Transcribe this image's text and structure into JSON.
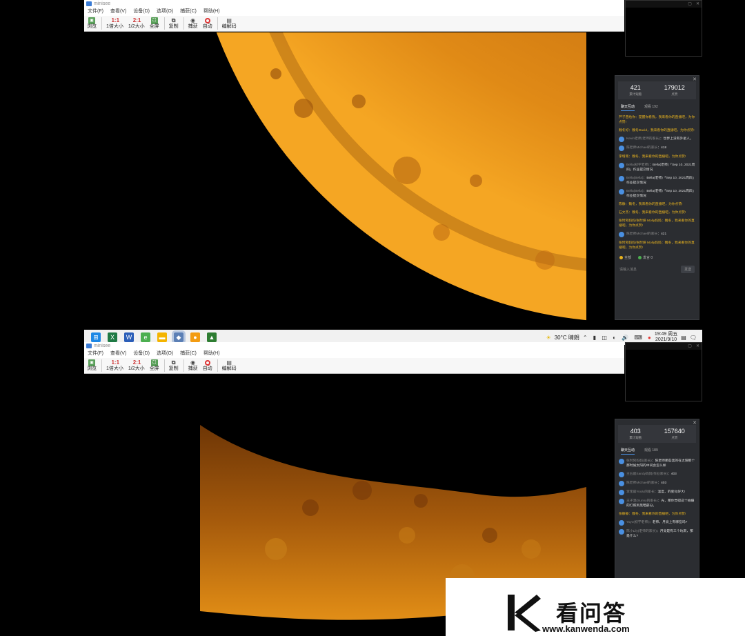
{
  "app": {
    "title": "minisee",
    "menus": [
      "文件(F)",
      "查看(V)",
      "设备(D)",
      "选项(O)",
      "捕获(C)",
      "帮助(H)"
    ],
    "toolbar": [
      {
        "icon": "image-icon",
        "glyph": "▣",
        "label": "浏览"
      },
      {
        "icon": "scale-1-1-icon",
        "glyph": "1:1",
        "label": "1倍大小"
      },
      {
        "icon": "scale-2-1-icon",
        "glyph": "2:1",
        "label": "1/2大小"
      },
      {
        "icon": "fullscreen-icon",
        "glyph": "⛶",
        "label": "全屏"
      },
      {
        "icon": "copy-icon",
        "glyph": "⧉",
        "label": "复制"
      },
      {
        "icon": "camera-icon",
        "glyph": "◉",
        "label": "捕获"
      },
      {
        "icon": "record-icon",
        "glyph": "",
        "label": "自动"
      },
      {
        "icon": "edit-icon",
        "glyph": "▤",
        "label": "编解码"
      }
    ]
  },
  "panel_top": {
    "stats": [
      {
        "num": "421",
        "label": "累计观看"
      },
      {
        "num": "179012",
        "label": "点赞"
      }
    ],
    "tabs": [
      "聊天互动",
      "观看 192"
    ],
    "messages": [
      {
        "kind": "yellow",
        "text": "芦子苗给你：提醒你看我，我来看你的直播吧，为你点赞!"
      },
      {
        "kind": "yellow",
        "text": "魏冬好：魏冬David，我来看你的直播吧，为你点赞!"
      },
      {
        "kind": "user",
        "nick": "Kevin老师(老师的家长)",
        "text": "：世界上没有外星人。"
      },
      {
        "kind": "user",
        "nick": "陈老师Michael的家长",
        "text": "：418"
      },
      {
        "kind": "yellow",
        "text": "李增南：魏冬，我来看你的直播吧，为你点赞!"
      },
      {
        "kind": "user",
        "nick": "Bella(初学老师)",
        "text": "：Bella(老师)「Sep 10, 2021周四」作业提交情况"
      },
      {
        "kind": "user",
        "nick": "Bella(Bella)",
        "text": "：Bella(老师)「Sep 10, 2021周四」作业提交情况"
      },
      {
        "kind": "user",
        "nick": "Bella(Bella)",
        "text": "：Bella(老师)「Sep 10, 2021周四」作业提交情况"
      },
      {
        "kind": "yellow",
        "text": "陈静：魏冬，我来看你的直播吧，为你点赞!"
      },
      {
        "kind": "yellow",
        "text": "石文杰：魏冬，我来看你的直播吧，为你点赞!"
      },
      {
        "kind": "yellow",
        "text": "张时阿妈妈/张时妍 Molly妈妈：魏冬，我来看你的直播吧，为你点赞!"
      },
      {
        "kind": "user",
        "nick": "陈老师Michael的家长",
        "text": "：421"
      },
      {
        "kind": "yellow",
        "text": "张时阿妈妈/张时妍 Molly妈妈：魏冬，我来看你的直播吧，为你点赞!"
      }
    ],
    "footer": [
      "全部",
      "发言 0"
    ],
    "input_placeholder": "请输入消息",
    "send_label": "发送"
  },
  "panel_bottom": {
    "stats": [
      {
        "num": "403",
        "label": "累计观看"
      },
      {
        "num": "157640",
        "label": "点赞"
      }
    ],
    "tabs": [
      "聊天互动",
      "观看 189"
    ],
    "messages": [
      {
        "kind": "user",
        "nick": "张时阿妈妈(家长)",
        "text": "：陈老师那些黑的在太阳那个那时候太阳的中间会怎么样"
      },
      {
        "kind": "user",
        "nick": "王五是Sandy妈妈(作业家长)",
        "text": "：403"
      },
      {
        "kind": "user",
        "nick": "陈老师Michael的家长",
        "text": "：403"
      },
      {
        "kind": "user",
        "nick": "李宝是Youlu的家长",
        "text": "：温度，的变化好大!"
      },
      {
        "kind": "user",
        "nick": "王子澳(Sunny的家长)",
        "text": "：光，那你觉得这个拍摄的灯照到黑暗部分。"
      },
      {
        "kind": "yellow",
        "text": "张静静：魏冬，我来看你的直播吧，为你点赞!"
      },
      {
        "kind": "user",
        "nick": "Yoyo(初学老师)",
        "text": "：老师，月亮上有哪些吗?"
      },
      {
        "kind": "user",
        "nick": "陈小Lily(老师的家长)",
        "text": "：月亮是有三个坑洞，那是什么?"
      }
    ]
  },
  "taskbar": {
    "apps": [
      {
        "icon": "windows-start-icon",
        "color": "#1e88e5",
        "glyph": "⊞"
      },
      {
        "icon": "excel-icon",
        "color": "#1f7a45",
        "glyph": "X"
      },
      {
        "icon": "word-icon",
        "color": "#2b5eb8",
        "glyph": "W"
      },
      {
        "icon": "browser-icon",
        "color": "#4caf50",
        "glyph": "e"
      },
      {
        "icon": "folder-icon",
        "color": "#f4b400",
        "glyph": "▬"
      },
      {
        "icon": "active-app-icon",
        "color": "#5b7fb5",
        "glyph": "◆"
      },
      {
        "icon": "orange-app-icon",
        "color": "#f39c12",
        "glyph": "●"
      },
      {
        "icon": "photo-app-icon",
        "color": "#2e7d32",
        "glyph": "▲"
      }
    ],
    "weather": "30°C  晴朗",
    "time": "19:49 周五",
    "date": "2021/9/10"
  },
  "watermark": {
    "text": "看问答",
    "url": "www.kanwenda.com"
  }
}
